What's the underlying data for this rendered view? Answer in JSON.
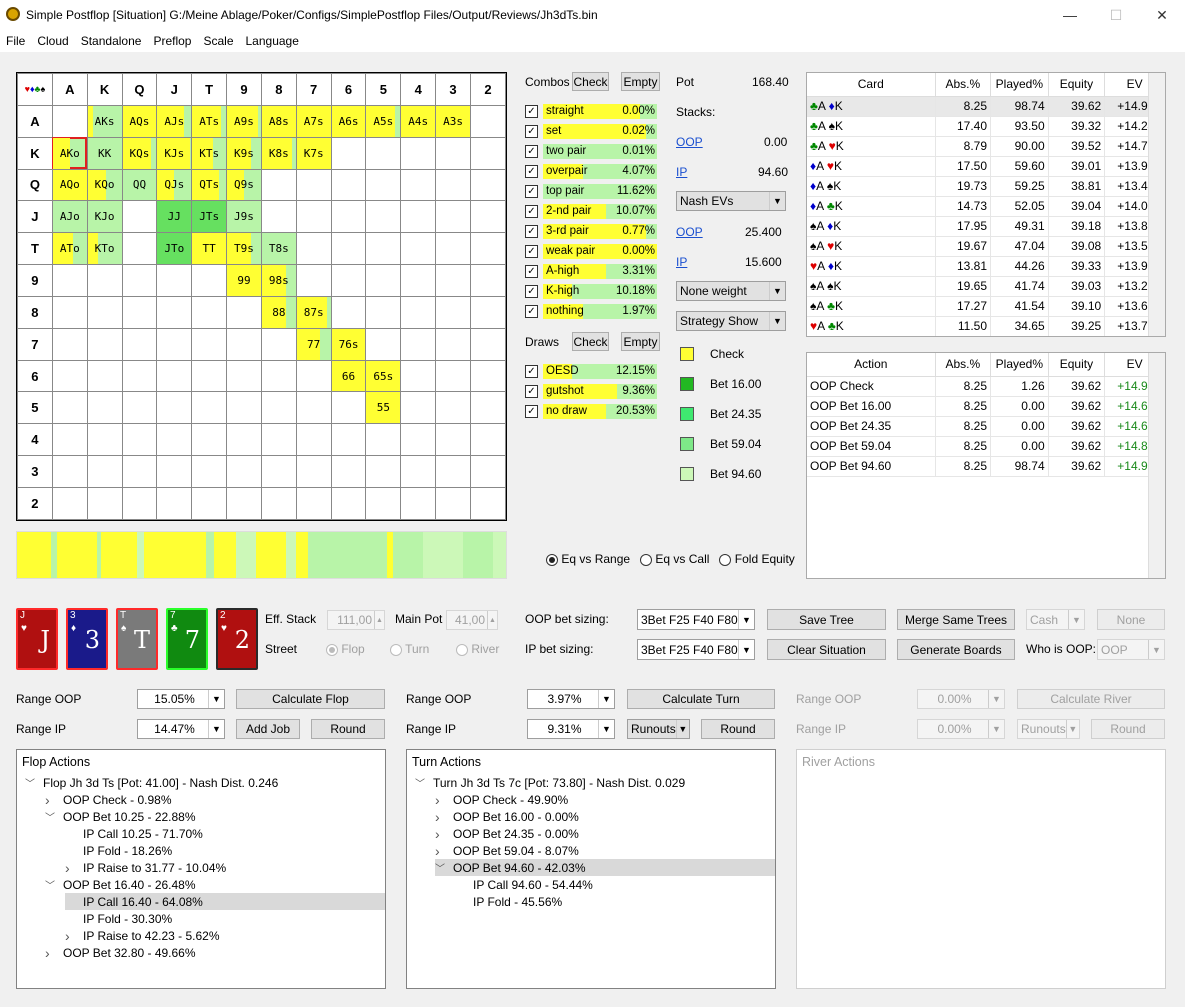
{
  "window": {
    "title": "Simple Postflop [Situation] G:/Meine Ablage/Poker/Configs/SimplePostflop Files/Output/Reviews/Jh3dTs.bin",
    "minimize": "—",
    "maximize": "☐",
    "close": "✕"
  },
  "menu": [
    "File",
    "Cloud",
    "Standalone",
    "Preflop",
    "Scale",
    "Language"
  ],
  "grid": {
    "ranks": [
      "A",
      "K",
      "Q",
      "J",
      "T",
      "9",
      "8",
      "7",
      "6",
      "5",
      "4",
      "3",
      "2"
    ],
    "corner": "♥♦♣♠",
    "cells": [
      [
        "",
        "AKs",
        "AQs",
        "AJs",
        "ATs",
        "A9s",
        "A8s",
        "A7s",
        "A6s",
        "A5s",
        "A4s",
        "A3s",
        ""
      ],
      [
        "AKo",
        "KK",
        "KQs",
        "KJs",
        "KTs",
        "K9s",
        "K8s",
        "K7s",
        "",
        "",
        "",
        "",
        ""
      ],
      [
        "AQo",
        "KQo",
        "QQ",
        "QJs",
        "QTs",
        "Q9s",
        "",
        "",
        "",
        "",
        "",
        "",
        ""
      ],
      [
        "AJo",
        "KJo",
        "",
        "JJ",
        "JTs",
        "J9s",
        "",
        "",
        "",
        "",
        "",
        "",
        ""
      ],
      [
        "ATo",
        "KTo",
        "",
        "JTo",
        "TT",
        "T9s",
        "T8s",
        "",
        "",
        "",
        "",
        "",
        ""
      ],
      [
        "",
        "",
        "",
        "",
        "",
        "99",
        "98s",
        "",
        "",
        "",
        "",
        "",
        ""
      ],
      [
        "",
        "",
        "",
        "",
        "",
        "",
        "88",
        "87s",
        "",
        "",
        "",
        "",
        ""
      ],
      [
        "",
        "",
        "",
        "",
        "",
        "",
        "",
        "77",
        "76s",
        "",
        "",
        "",
        ""
      ],
      [
        "",
        "",
        "",
        "",
        "",
        "",
        "",
        "",
        "66",
        "65s",
        "",
        "",
        ""
      ],
      [
        "",
        "",
        "",
        "",
        "",
        "",
        "",
        "",
        "",
        "55",
        "",
        "",
        ""
      ],
      [
        "",
        "",
        "",
        "",
        "",
        "",
        "",
        "",
        "",
        "",
        "",
        "",
        ""
      ],
      [
        "",
        "",
        "",
        "",
        "",
        "",
        "",
        "",
        "",
        "",
        "",
        "",
        ""
      ],
      [
        "",
        "",
        "",
        "",
        "",
        "",
        "",
        "",
        "",
        "",
        "",
        "",
        ""
      ]
    ],
    "selected": "AKo"
  },
  "combos": {
    "label": "Combos",
    "check_btn": "Check",
    "empty_btn": "Empty",
    "items": [
      {
        "name": "straight",
        "pct": "0.00%",
        "fill": 0.85
      },
      {
        "name": "set",
        "pct": "0.02%",
        "fill": 0.9
      },
      {
        "name": "two pair",
        "pct": "0.01%",
        "fill": 0.0
      },
      {
        "name": "overpair",
        "pct": "4.07%",
        "fill": 0.35
      },
      {
        "name": "top pair",
        "pct": "11.62%",
        "fill": 0.0
      },
      {
        "name": "2-nd pair",
        "pct": "10.07%",
        "fill": 0.55
      },
      {
        "name": "3-rd pair",
        "pct": "0.77%",
        "fill": 0.9
      },
      {
        "name": "weak pair",
        "pct": "0.00%",
        "fill": 1.0
      },
      {
        "name": "A-high",
        "pct": "3.31%",
        "fill": 0.55
      },
      {
        "name": "K-high",
        "pct": "10.18%",
        "fill": 0.25
      },
      {
        "name": "nothing",
        "pct": "1.97%",
        "fill": 0.35
      }
    ]
  },
  "draws": {
    "label": "Draws",
    "check_btn": "Check",
    "empty_btn": "Empty",
    "items": [
      {
        "name": "OESD",
        "pct": "12.15%",
        "fill": 0.25
      },
      {
        "name": "gutshot",
        "pct": "9.36%",
        "fill": 0.65
      },
      {
        "name": "no draw",
        "pct": "20.53%",
        "fill": 0.55
      }
    ]
  },
  "pot": {
    "label": "Pot",
    "value": "168.40",
    "stacks_label": "Stacks:",
    "oop": "OOP",
    "oop_stack": "0.00",
    "ip": "IP",
    "ip_stack": "94.60",
    "mode": "Nash EVs",
    "oop_ev": "25.400",
    "ip_ev": "15.600",
    "weight": "None weight",
    "strategy": "Strategy Show"
  },
  "legend": [
    {
      "label": "Check",
      "color": "#ffff33"
    },
    {
      "label": "Bet 16.00",
      "color": "#22b822"
    },
    {
      "label": "Bet 24.35",
      "color": "#3fe870"
    },
    {
      "label": "Bet 59.04",
      "color": "#7ee888"
    },
    {
      "label": "Bet 94.60",
      "color": "#ccf8b8"
    }
  ],
  "card_table": {
    "headers": [
      "Card",
      "Abs.%",
      "Played%",
      "Equity",
      "EV"
    ],
    "rows": [
      [
        "♣A ♦K",
        "8.25",
        "98.74",
        "39.62",
        "+14.994"
      ],
      [
        "♣A ♠K",
        "17.40",
        "93.50",
        "39.32",
        "+14.244"
      ],
      [
        "♣A ♥K",
        "8.79",
        "90.00",
        "39.52",
        "+14.720"
      ],
      [
        "♦A ♥K",
        "17.50",
        "59.60",
        "39.01",
        "+13.964"
      ],
      [
        "♦A ♠K",
        "19.73",
        "59.25",
        "38.81",
        "+13.490"
      ],
      [
        "♦A ♣K",
        "14.73",
        "52.05",
        "39.04",
        "+14.037"
      ],
      [
        "♠A ♦K",
        "17.95",
        "49.31",
        "39.18",
        "+13.830"
      ],
      [
        "♠A ♥K",
        "19.67",
        "47.04",
        "39.08",
        "+13.561"
      ],
      [
        "♥A ♦K",
        "13.81",
        "44.26",
        "39.33",
        "+13.958"
      ],
      [
        "♠A ♠K",
        "19.65",
        "41.74",
        "39.03",
        "+13.218"
      ],
      [
        "♠A ♣K",
        "17.27",
        "41.54",
        "39.10",
        "+13.635"
      ],
      [
        "♥A ♣K",
        "11.50",
        "34.65",
        "39.25",
        "+13.762"
      ]
    ]
  },
  "action_table": {
    "headers": [
      "Action",
      "Abs.%",
      "Played%",
      "Equity",
      "EV"
    ],
    "rows": [
      [
        "OOP Check",
        "8.25",
        "1.26",
        "39.62",
        "+14.942"
      ],
      [
        "OOP Bet 16.00",
        "8.25",
        "0.00",
        "39.62",
        "+14.659"
      ],
      [
        "OOP Bet 24.35",
        "8.25",
        "0.00",
        "39.62",
        "+14.614"
      ],
      [
        "OOP Bet 59.04",
        "8.25",
        "0.00",
        "39.62",
        "+14.804"
      ],
      [
        "OOP Bet 94.60",
        "8.25",
        "98.74",
        "39.62",
        "+14.994"
      ]
    ]
  },
  "eq_options": [
    "Eq vs Range",
    "Eq vs Call",
    "Fold Equity"
  ],
  "cards": [
    {
      "rank": "J",
      "suit": "♥",
      "color": "#b01010",
      "border": "#ff2a2a"
    },
    {
      "rank": "3",
      "suit": "♦",
      "color": "#1a1a8a",
      "border": "#ff2a2a"
    },
    {
      "rank": "T",
      "suit": "♠",
      "color": "#7a7a7a",
      "border": "#ff2a2a"
    },
    {
      "rank": "7",
      "suit": "♣",
      "color": "#108a10",
      "border": "#2aff2a"
    },
    {
      "rank": "2",
      "suit": "♥",
      "color": "#b01010",
      "border": "#2a2a2a"
    }
  ],
  "controls": {
    "eff_stack_label": "Eff. Stack",
    "eff_stack": "111,00",
    "main_pot_label": "Main Pot",
    "main_pot": "41,00",
    "street_label": "Street",
    "streets": [
      "Flop",
      "Turn",
      "River"
    ],
    "oop_sizing_label": "OOP bet sizing:",
    "oop_sizing": "3Bet F25 F40 F80",
    "ip_sizing_label": "IP bet sizing:",
    "ip_sizing": "3Bet F25 F40 F80",
    "save_tree": "Save Tree",
    "merge": "Merge Same Trees",
    "cash": "Cash",
    "none": "None",
    "clear": "Clear Situation",
    "generate": "Generate Boards",
    "who_oop": "Who is OOP:",
    "who_oop_val": "OOP"
  },
  "flop": {
    "range_oop_label": "Range OOP",
    "range_oop": "15.05%",
    "calc": "Calculate Flop",
    "range_ip_label": "Range IP",
    "range_ip": "14.47%",
    "add_job": "Add Job",
    "round": "Round"
  },
  "turn": {
    "range_oop_label": "Range OOP",
    "range_oop": "3.97%",
    "calc": "Calculate Turn",
    "range_ip_label": "Range IP",
    "range_ip": "9.31%",
    "runouts": "Runouts",
    "round": "Round"
  },
  "river": {
    "range_oop_label": "Range OOP",
    "range_oop": "0.00%",
    "calc": "Calculate River",
    "range_ip_label": "Range IP",
    "range_ip": "0.00%",
    "runouts": "Runouts",
    "round": "Round"
  },
  "flop_actions": {
    "title": "Flop Actions",
    "items": [
      {
        "text": "Flop Jh 3d Ts [Pot: 41.00] - Nash Dist. 0.246",
        "lvl": 0,
        "arrow": "v"
      },
      {
        "text": "OOP Check - 0.98%",
        "lvl": 1,
        "arrow": ">"
      },
      {
        "text": "OOP Bet 10.25 - 22.88%",
        "lvl": 1,
        "arrow": "v"
      },
      {
        "text": "IP Call 10.25 - 71.70%",
        "lvl": 2,
        "arrow": ""
      },
      {
        "text": "IP Fold - 18.26%",
        "lvl": 2,
        "arrow": ""
      },
      {
        "text": "IP Raise to 31.77 - 10.04%",
        "lvl": 2,
        "arrow": ">"
      },
      {
        "text": "OOP Bet 16.40 - 26.48%",
        "lvl": 1,
        "arrow": "v"
      },
      {
        "text": "IP Call 16.40 - 64.08%",
        "lvl": 2,
        "arrow": "",
        "hl": true
      },
      {
        "text": "IP Fold - 30.30%",
        "lvl": 2,
        "arrow": ""
      },
      {
        "text": "IP Raise to 42.23 - 5.62%",
        "lvl": 2,
        "arrow": ">"
      },
      {
        "text": "OOP Bet 32.80 - 49.66%",
        "lvl": 1,
        "arrow": ">"
      }
    ]
  },
  "turn_actions": {
    "title": "Turn Actions",
    "items": [
      {
        "text": "Turn Jh 3d Ts 7c [Pot: 73.80] - Nash Dist. 0.029",
        "lvl": 0,
        "arrow": "v"
      },
      {
        "text": "OOP Check - 49.90%",
        "lvl": 1,
        "arrow": ">"
      },
      {
        "text": "OOP Bet 16.00 - 0.00%",
        "lvl": 1,
        "arrow": ">"
      },
      {
        "text": "OOP Bet 24.35 - 0.00%",
        "lvl": 1,
        "arrow": ">"
      },
      {
        "text": "OOP Bet 59.04 - 8.07%",
        "lvl": 1,
        "arrow": ">"
      },
      {
        "text": "OOP Bet 94.60 - 42.03%",
        "lvl": 1,
        "arrow": "v",
        "hl": true
      },
      {
        "text": "IP Call 94.60 - 54.44%",
        "lvl": 2,
        "arrow": ""
      },
      {
        "text": "IP Fold - 45.56%",
        "lvl": 2,
        "arrow": ""
      }
    ]
  },
  "river_actions": {
    "title": "River Actions"
  }
}
